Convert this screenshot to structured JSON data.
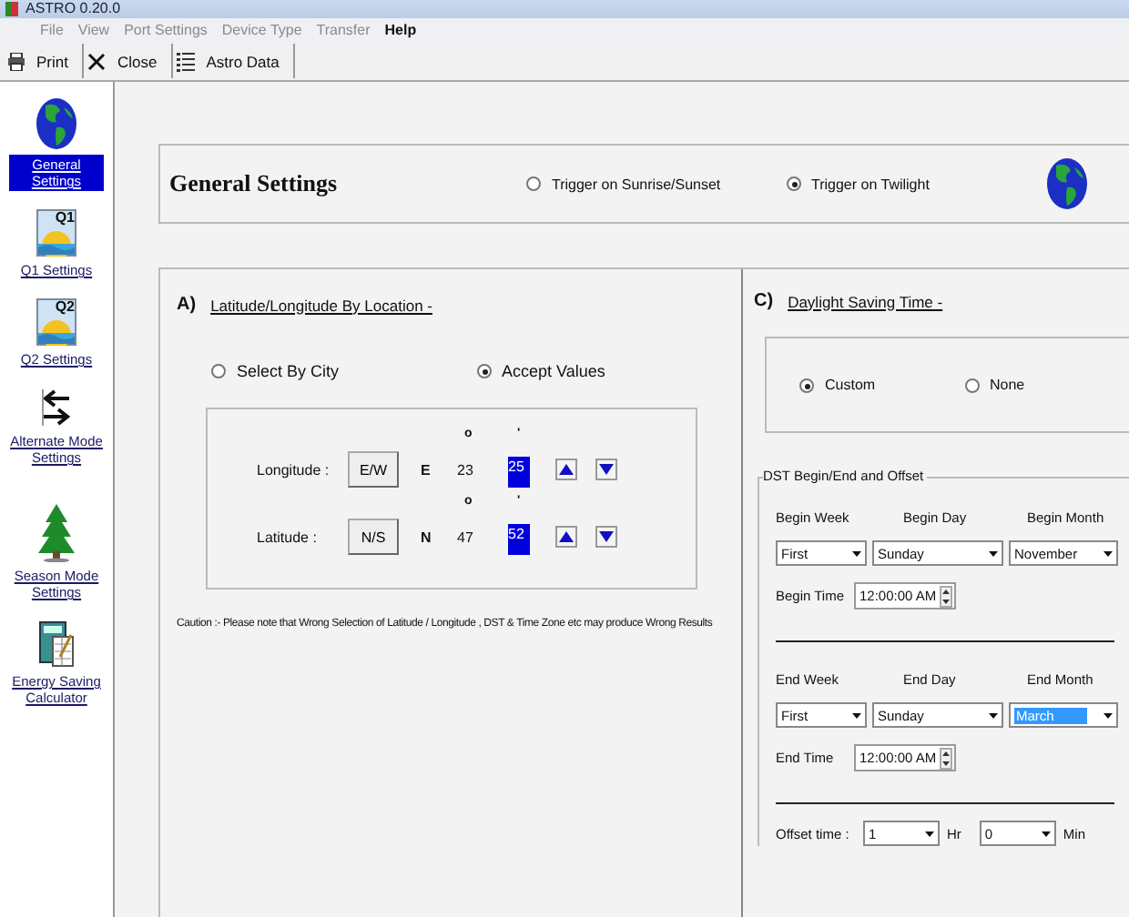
{
  "window": {
    "title": "ASTRO 0.20.0"
  },
  "menu": [
    {
      "label": "File",
      "disabled": true
    },
    {
      "label": "View",
      "disabled": true
    },
    {
      "label": "Port Settings",
      "disabled": true
    },
    {
      "label": "Device Type",
      "disabled": true
    },
    {
      "label": "Transfer",
      "disabled": true
    },
    {
      "label": "Help",
      "disabled": false
    }
  ],
  "toolbar": [
    {
      "label": "Print",
      "kind": "printer"
    },
    {
      "label": "Close",
      "kind": "cross"
    },
    {
      "label": "Astro Data",
      "kind": "list"
    }
  ],
  "sidebar": {
    "items": [
      {
        "label": "General Settings",
        "kind": "globe",
        "selected": true
      },
      {
        "label": "Q1 Settings",
        "kind": "sunrise",
        "icon_text": "Q1",
        "selected": false
      },
      {
        "label": "Q2 Settings",
        "kind": "sunrise",
        "icon_text": "Q2",
        "selected": false
      },
      {
        "label": "Alternate Mode Settings",
        "kind": "arrows",
        "selected": false
      },
      {
        "label": "Season Mode Settings",
        "kind": "tree",
        "selected": false
      },
      {
        "label": "Energy Saving Calculator",
        "kind": "calculator",
        "selected": false
      }
    ]
  },
  "header": {
    "title": "General Settings",
    "options": [
      {
        "label": "Trigger on Sunrise/Sunset",
        "selected": false
      },
      {
        "label": "Trigger on Twilight",
        "selected": true
      }
    ]
  },
  "location": {
    "marker": "A)",
    "title": "Latitude/Longitude By Location -",
    "modes": [
      {
        "label": "Select By City",
        "selected": false
      },
      {
        "label": "Accept Values",
        "selected": true
      }
    ],
    "coordinates": [
      {
        "label": "Longitude :",
        "button": "E/W",
        "hemisphere": "E",
        "degree_mark": "o",
        "minute_mark": "'",
        "degrees": "23",
        "minutes": "25",
        "minutes_selected": true
      },
      {
        "label": "Latitude :",
        "button": "N/S",
        "hemisphere": "N",
        "degree_mark": "o",
        "minute_mark": "'",
        "degrees": "47",
        "minutes": "52",
        "minutes_selected": true
      }
    ],
    "caution": "Caution :- Please note that Wrong Selection of Latitude / Longitude , DST & Time Zone etc may produce Wrong Results"
  },
  "dst": {
    "marker": "C)",
    "title": "Daylight Saving Time -",
    "modes": [
      {
        "label": "Custom",
        "selected": true
      },
      {
        "label": "None",
        "selected": false
      }
    ],
    "group_title": "DST Begin/End and Offset",
    "periods": [
      {
        "fields": [
          {
            "label": "Begin Week",
            "value": "First",
            "focused": false
          },
          {
            "label": "Begin Day",
            "value": "Sunday",
            "focused": false
          },
          {
            "label": "Begin Month",
            "value": "November",
            "focused": false
          }
        ],
        "time_label": "Begin Time",
        "time": "12:00:00 AM"
      },
      {
        "fields": [
          {
            "label": "End Week",
            "value": "First",
            "focused": false
          },
          {
            "label": "End Day",
            "value": "Sunday",
            "focused": false
          },
          {
            "label": "End Month",
            "value": "March",
            "focused": true
          }
        ],
        "time_label": "End Time",
        "time": "12:00:00 AM"
      }
    ],
    "offset": {
      "label": "Offset time :",
      "hours": "1",
      "hours_unit": "Hr",
      "minutes": "0",
      "minutes_unit": "Min"
    }
  }
}
